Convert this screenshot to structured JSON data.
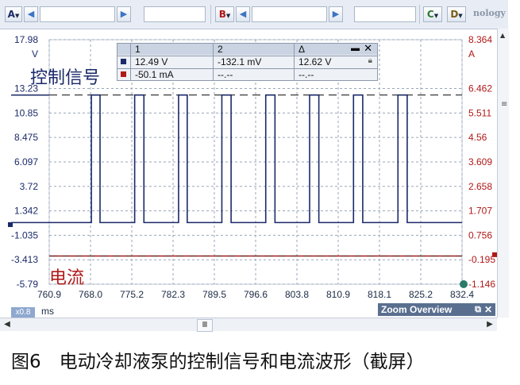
{
  "toolbar": {
    "channels": [
      {
        "letter": "A",
        "color": "#1b2a6a"
      },
      {
        "letter": "B",
        "color": "#b01818"
      },
      {
        "letter": "C",
        "color": "#2f7a2f"
      },
      {
        "letter": "D",
        "color": "#7a5a10"
      }
    ],
    "brand": "nology"
  },
  "axes": {
    "left_unit": "V",
    "left_ticks": [
      "17.98",
      "13.23",
      "10.85",
      "8.475",
      "6.097",
      "3.72",
      "1.342",
      "-1.035",
      "-3.413",
      "-5.79"
    ],
    "right_unit": "A",
    "right_ticks": [
      "8.364",
      "6.462",
      "5.511",
      "4.56",
      "3.609",
      "2.658",
      "1.707",
      "0.756",
      "-0.195",
      "-1.146"
    ],
    "x_ticks": [
      "760.9",
      "768.0",
      "775.2",
      "782.3",
      "789.5",
      "796.6",
      "803.8",
      "810.9",
      "818.1",
      "825.2",
      "832.4"
    ],
    "x_unit": "ms",
    "x_scale": "x0.8"
  },
  "measurements": {
    "headers": [
      "1",
      "2",
      "Δ"
    ],
    "rows": [
      {
        "color": "#1b2a6a",
        "values": [
          "12.49 V",
          "-132.1 mV",
          "12.62 V"
        ]
      },
      {
        "color": "#b01818",
        "values": [
          "-50.1 mA",
          "--.--",
          "--.--"
        ]
      }
    ]
  },
  "labels": {
    "control_signal": "控制信号",
    "current": "电流"
  },
  "zoom_overview": {
    "title": "Zoom Overview"
  },
  "caption": "图6　电动冷却液泵的控制信号和电流波形（截屏）",
  "colors": {
    "channel_a": "#1b2a6a",
    "channel_b": "#b01818",
    "grid": "#9aa6b8"
  },
  "chart_data": {
    "type": "line",
    "x_unit": "ms",
    "x_range": [
      760.9,
      832.4
    ],
    "series": [
      {
        "name": "控制信号",
        "unit": "V",
        "levels": {
          "low": 0.2,
          "high": 12.6
        },
        "pulses": [
          [
            768.2,
            769.7
          ],
          [
            775.7,
            777.3
          ],
          [
            783.3,
            784.8
          ],
          [
            790.8,
            792.4
          ],
          [
            798.4,
            800.0
          ],
          [
            806.0,
            807.6
          ],
          [
            813.6,
            815.2
          ],
          [
            821.3,
            822.9
          ]
        ]
      },
      {
        "name": "电流",
        "unit": "A",
        "values_constant": -0.05
      }
    ]
  }
}
